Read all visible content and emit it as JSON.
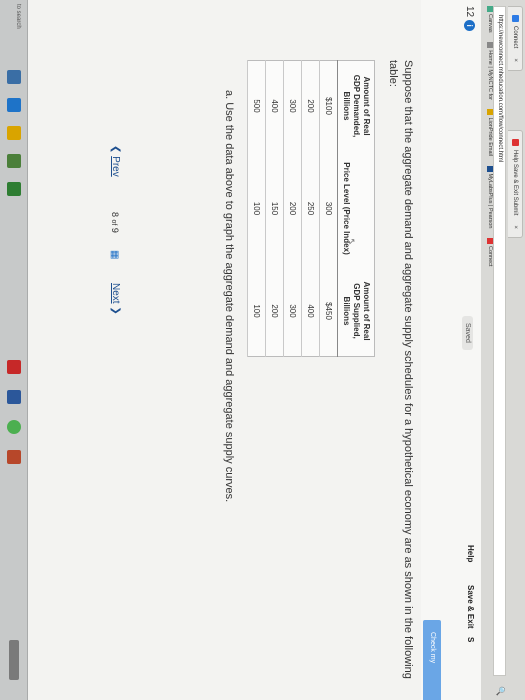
{
  "browser": {
    "tabs": [
      {
        "label": "Connect",
        "close": "×"
      },
      {
        "label": "Help Save & Exit Submit",
        "close": "×"
      }
    ],
    "url": "https://newconnect.mheducation.com/flow/connect.html",
    "bookmarks": [
      "Canvas",
      "Home | MyNCTC for",
      "LionPride Email",
      "MyLabsPlus | Pearson",
      "Connect"
    ]
  },
  "app": {
    "question_number": "12",
    "saved": "Saved",
    "help": "Help",
    "save_exit": "Save & Exit",
    "submit": "S",
    "check_my": "Check my"
  },
  "question": {
    "text": "Suppose that the aggregate demand and aggregate supply schedules for a hypothetical economy are as shown in the following table:",
    "sub_a": "a. Use the data above to graph the aggregate demand and aggregate supply curves."
  },
  "table": {
    "headers": [
      "Amount of Real GDP Demanded, Billions",
      "Price Level (Price Index)",
      "Amount of Real GDP Supplied, Billions"
    ],
    "rows": [
      [
        "$100",
        "300",
        "$450"
      ],
      [
        "200",
        "250",
        "400"
      ],
      [
        "300",
        "200",
        "300"
      ],
      [
        "400",
        "150",
        "200"
      ],
      [
        "500",
        "100",
        "100"
      ]
    ]
  },
  "pager": {
    "prev": "Prev",
    "current": "8",
    "of": "of",
    "total": "9",
    "next": "Next"
  },
  "taskbar": {
    "search": "to search"
  }
}
